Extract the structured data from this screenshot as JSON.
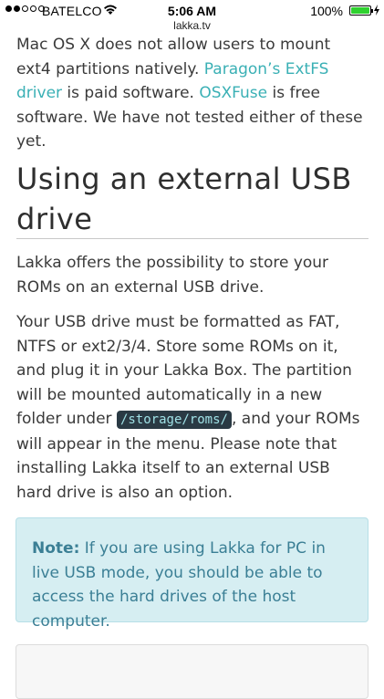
{
  "status_bar": {
    "carrier": "BATELCO",
    "time": "5:06 AM",
    "battery_percent": "100%",
    "signal_bars": 2,
    "battery_level": 1.0,
    "battery_color": "#2fd12f"
  },
  "browser": {
    "url": "lakka.tv"
  },
  "article": {
    "intro_text_1": "Mac OS X does not allow users to mount ext4 partitions natively. ",
    "paragon_link": "Paragon’s ExtFS driver",
    "intro_text_2": " is paid software. ",
    "osxfuse_link": "OSXFuse",
    "intro_text_3": " is free software. We have not tested either of these yet.",
    "heading": "Using an external USB drive",
    "para1": "Lakka offers the possibility to store your ROMs on an external USB drive.",
    "para2_a": "Your USB drive must be formatted as FAT, NTFS or ext2/3/4. Store some ROMs on it, and plug it in your Lakka Box. The partition will be mounted automatically in a new folder under ",
    "para2_code": "/storage/roms/",
    "para2_b": ", and your ROMs will appear in the menu. Please note that installing Lakka itself to an external USB hard drive is also an option.",
    "note_label": "Note:",
    "note_text": " If you are using Lakka for PC in live USB mode, you should be able to access the hard drives of the host computer."
  },
  "colors": {
    "link": "#3ab0b5",
    "note_background": "#d6eef2",
    "note_text": "#3b7f95",
    "code_background": "#2a3a44"
  }
}
